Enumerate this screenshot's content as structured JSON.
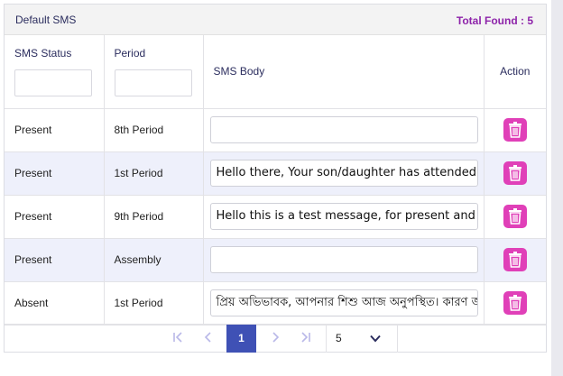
{
  "panel": {
    "title": "Default SMS",
    "total_found": "Total Found : 5"
  },
  "table": {
    "headers": {
      "sms_status": "SMS Status",
      "period": "Period",
      "sms_body": "SMS Body",
      "action": "Action"
    },
    "rows": [
      {
        "status": "Present",
        "period": "8th Period",
        "body": ""
      },
      {
        "status": "Present",
        "period": "1st Period",
        "body": "Hello there, Your son/daughter has attended school today"
      },
      {
        "status": "Present",
        "period": "9th Period",
        "body": "Hello this is a test message, for present and absent"
      },
      {
        "status": "Present",
        "period": "Assembly",
        "body": ""
      },
      {
        "status": "Absent",
        "period": "1st Period",
        "body": "প্রিয় অভিভাবক, আপনার শিশু আজ অনুপস্থিত। কারণ জানান"
      }
    ]
  },
  "pagination": {
    "first": "|<",
    "prev": "<",
    "current_page": "1",
    "next": ">",
    "last": ">|",
    "page_size": "5"
  },
  "colors": {
    "accent": "#3f51b5",
    "delete": "#e040b8",
    "total_found": "#8e24aa"
  }
}
